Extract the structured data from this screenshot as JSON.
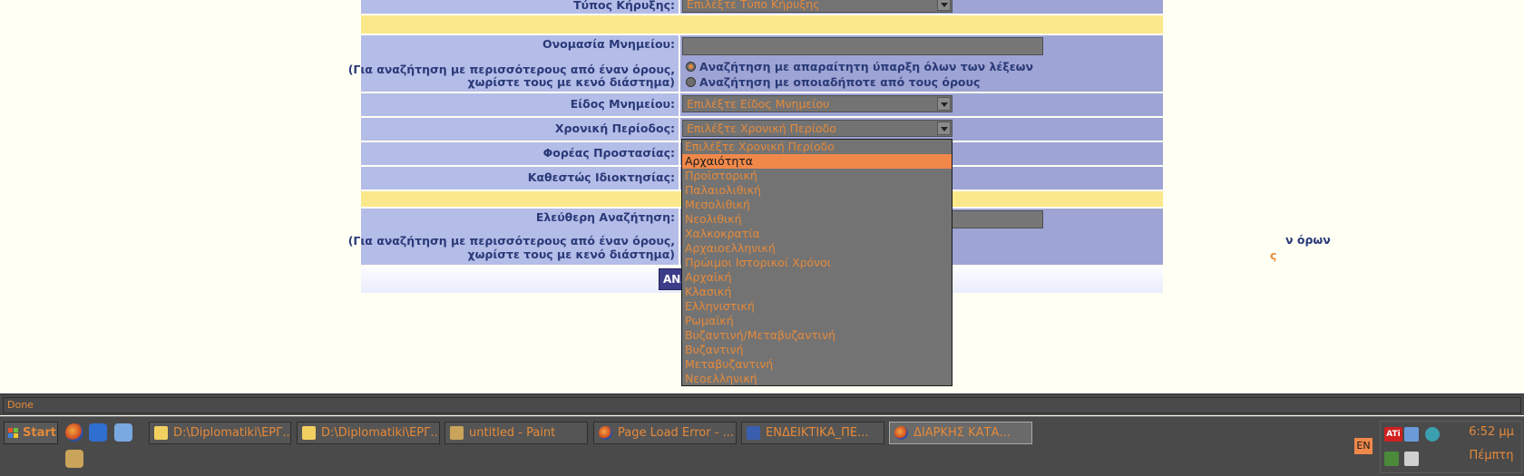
{
  "form": {
    "announcement_type_label": "Τύπος Κήρυξης:",
    "announcement_type_value": "Επιλέξτε Τύπο Κήρυξης",
    "monument_name_label": "Ονομασία Μνημείου:",
    "monument_name_hint_1": "(Για αναζήτηση με περισσότερους από έναν όρους,",
    "monument_name_hint_2": "χωρίστε τους με κενό διάστημα)",
    "radio_all": "Αναζήτηση με απαραίτητη ύπαρξη όλων των λέξεων",
    "radio_any": "Αναζήτηση με οποιαδήποτε από τους όρους",
    "monument_type_label": "Είδος Μνημείου:",
    "monument_type_value": "Επιλέξτε Είδος Μνημείου",
    "period_label": "Χρονική Περίοδος:",
    "period_value": "Επιλέξτε Χρονική Περίοδο",
    "protection_label": "Φορέας Προστασίας:",
    "ownership_label": "Καθεστώς Ιδιοκτησίας:",
    "free_search_label": "Ελεύθερη Αναζήτηση:",
    "free_search_hint_1": "(Για αναζήτηση με περισσότερους από έναν όρους,",
    "free_search_hint_2": "χωρίστε τους με κενό διάστημα)",
    "free_search_radio_tail_1": "ν όρων",
    "free_search_radio_tail_2": "ς",
    "search_button": "ΑΝΑ"
  },
  "dropdown": {
    "options": [
      "Επιλέξτε Χρονική Περίοδο",
      "Αρχαιότητα",
      "Προϊστορική",
      "Παλαιολιθική",
      "Μεσολιθική",
      "Νεολιθική",
      "Χαλκοκρατία",
      "Αρχαιοελληνική",
      "Πρώιμοι Ιστορικοί Χρόνοι",
      "Αρχαϊκή",
      "Κλασική",
      "Ελληνιστική",
      "Ρωμαϊκή",
      "Βυζαντινή/Μεταβυζαντινή",
      "Βυζαντινή",
      "Μεταβυζαντινή",
      "Νεοελληνική"
    ],
    "highlighted": "Αρχαιότητα"
  },
  "statusbar": {
    "text": "Done"
  },
  "taskbar": {
    "start": "Start",
    "tasks": [
      "D:\\Diplomatiki\\ΕΡΓ...",
      "D:\\Diplomatiki\\ΕΡΓ...",
      "untitled - Paint",
      "Page Load Error - ...",
      "ΕΝΔΕΙΚΤΙΚΑ_ΠΕ...",
      "ΔΙΑΡΚΗΣ ΚΑΤΑ..."
    ],
    "language": "EN",
    "clock": "6:52 μμ",
    "day": "Πέμπτη",
    "tray_ati": "ATi"
  },
  "colors": {
    "label_bg": "#b4bce8",
    "field_bg": "#9ea4d4",
    "separator_bg": "#fbe88a",
    "accent_text": "#e58a3a",
    "highlight": "#f0884a",
    "taskbar_bg": "#4a4a4a"
  }
}
